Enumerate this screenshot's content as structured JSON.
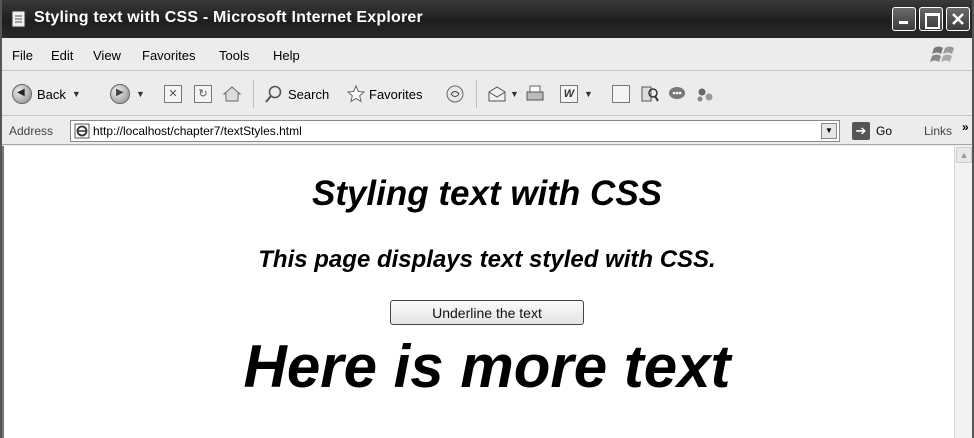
{
  "window": {
    "title": "Styling text with CSS - Microsoft Internet Explorer"
  },
  "menu": {
    "items": [
      "File",
      "Edit",
      "View",
      "Favorites",
      "Tools",
      "Help"
    ]
  },
  "toolbar": {
    "back_label": "Back",
    "search_label": "Search",
    "favorites_label": "Favorites"
  },
  "address": {
    "label": "Address",
    "url": "http://localhost/chapter7/textStyles.html",
    "go_label": "Go",
    "links_label": "Links"
  },
  "page": {
    "heading": "Styling text with CSS",
    "subheading": "This page displays text styled with CSS.",
    "button_label": "Underline the text",
    "large_text": "Here is more text"
  }
}
